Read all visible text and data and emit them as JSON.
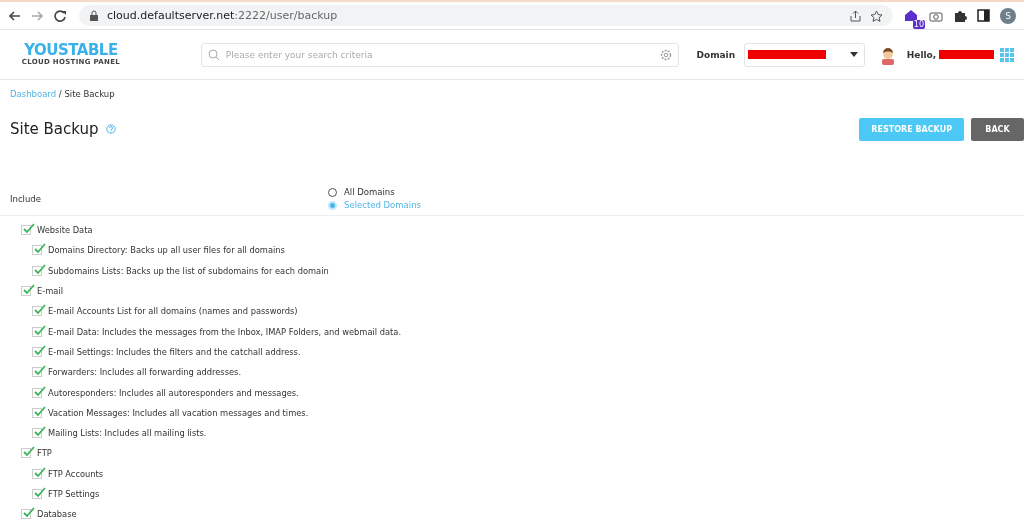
{
  "browser": {
    "url_host": "cloud.defaultserver.net",
    "url_path": ":2222/user/backup",
    "extension_badge": "10",
    "profile_initial": "S"
  },
  "header": {
    "logo": "YOUSTABLE",
    "logo_tagline": "CLOUD HOSTING PANEL",
    "search": {
      "placeholder": "Please enter your search criteria"
    },
    "domain_label": "Domain",
    "greeting": "Hello,"
  },
  "breadcrumb": [
    {
      "label": "Dashboard",
      "kind": "link"
    },
    {
      "label": "/ Site Backup",
      "kind": "current"
    }
  ],
  "page_title": "Site Backup",
  "buttons": [
    {
      "label": "RESTORE BACKUP",
      "kind": "primary"
    },
    {
      "label": "BACK",
      "kind": "secondary"
    }
  ],
  "include": {
    "label": "Include",
    "options": [
      {
        "label": "All Domains",
        "selected": false
      },
      {
        "label": "Selected Domains",
        "selected": true
      }
    ]
  },
  "tree": [
    {
      "label": "Website Data",
      "checked": true,
      "children": [
        {
          "label": "Domains Directory: Backs up all user files for all domains",
          "checked": true
        },
        {
          "label": "Subdomains Lists: Backs up the list of subdomains for each domain",
          "checked": true
        }
      ]
    },
    {
      "label": "E-mail",
      "checked": true,
      "children": [
        {
          "label": "E-mail Accounts List for all domains (names and passwords)",
          "checked": true
        },
        {
          "label": "E-mail Data: Includes the messages from the Inbox, IMAP Folders, and webmail data.",
          "checked": true
        },
        {
          "label": "E-mail Settings: Includes the filters and the catchall address.",
          "checked": true
        },
        {
          "label": "Forwarders: Includes all forwarding addresses.",
          "checked": true
        },
        {
          "label": "Autoresponders: Includes all autoresponders and messages.",
          "checked": true
        },
        {
          "label": "Vacation Messages: Includes all vacation messages and times.",
          "checked": true
        },
        {
          "label": "Mailing Lists: Includes all mailing lists.",
          "checked": true
        }
      ]
    },
    {
      "label": "FTP",
      "checked": true,
      "children": [
        {
          "label": "FTP Accounts",
          "checked": true
        },
        {
          "label": "FTP Settings",
          "checked": true
        }
      ]
    },
    {
      "label": "Database",
      "checked": true
    }
  ]
}
